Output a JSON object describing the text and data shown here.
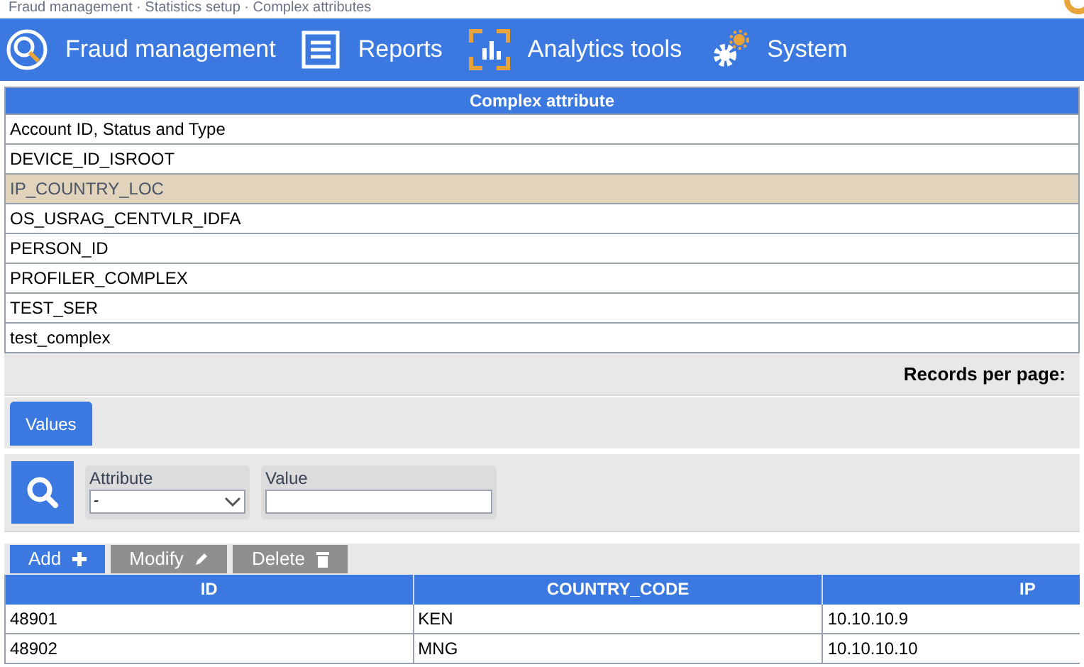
{
  "breadcrumb": "Fraud management · Statistics setup · Complex attributes",
  "nav": [
    {
      "label": "Fraud management",
      "kind": "fraud"
    },
    {
      "label": "Reports",
      "kind": "reports"
    },
    {
      "label": "Analytics tools",
      "kind": "analytics"
    },
    {
      "label": "System",
      "kind": "system"
    }
  ],
  "attributes_table": {
    "column": "Complex attribute",
    "rows": [
      {
        "label": "Account ID, Status and Type",
        "selected": false
      },
      {
        "label": "DEVICE_ID_ISROOT",
        "selected": false
      },
      {
        "label": "IP_COUNTRY_LOC",
        "selected": true
      },
      {
        "label": "OS_USRAG_CENTVLR_IDFA",
        "selected": false
      },
      {
        "label": "PERSON_ID",
        "selected": false
      },
      {
        "label": "PROFILER_COMPLEX",
        "selected": false
      },
      {
        "label": "TEST_SER",
        "selected": false
      },
      {
        "label": "test_complex",
        "selected": false
      }
    ]
  },
  "pager": {
    "label": "Records per page:"
  },
  "tabs": [
    {
      "label": "Values",
      "selected": true
    }
  ],
  "filters": [
    {
      "label": "Attribute",
      "kind": "select",
      "value": "-"
    },
    {
      "label": "Value",
      "kind": "text"
    }
  ],
  "actions": [
    {
      "label": "Add",
      "kind": "add",
      "disabled": false
    },
    {
      "label": "Modify",
      "kind": "modify",
      "disabled": true
    },
    {
      "label": "Delete",
      "kind": "delete",
      "disabled": true
    }
  ],
  "values_table": {
    "columns": [
      "ID",
      "COUNTRY_CODE",
      "IP"
    ],
    "rows": [
      [
        "48901",
        "KEN",
        "10.10.10.9"
      ],
      [
        "48902",
        "MNG",
        "10.10.10.10"
      ]
    ]
  }
}
